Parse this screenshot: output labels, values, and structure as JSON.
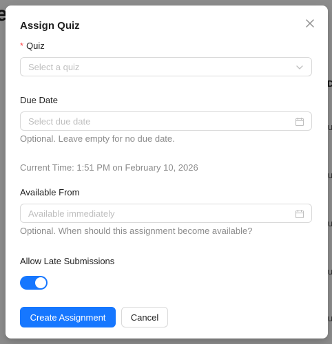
{
  "background": {
    "title_fragment": "e",
    "column_header_fragment": "D",
    "cell_fragment": "lu"
  },
  "modal": {
    "title": "Assign Quiz",
    "close_icon": "close-icon",
    "quiz": {
      "required_mark": "*",
      "label": "Quiz",
      "placeholder": "Select a quiz",
      "icon": "chevron-down-icon"
    },
    "due_date": {
      "label": "Due Date",
      "placeholder": "Select due date",
      "icon": "calendar-icon",
      "help": "Optional. Leave empty for no due date."
    },
    "current_time": "Current Time: 1:51 PM on February 10, 2026",
    "available_from": {
      "label": "Available From",
      "placeholder": "Available immediately",
      "icon": "calendar-icon",
      "help": "Optional. When should this assignment become available?"
    },
    "late_submissions": {
      "label": "Allow Late Submissions",
      "enabled": true
    },
    "buttons": {
      "create": "Create Assignment",
      "cancel": "Cancel"
    }
  },
  "colors": {
    "primary": "#1677ff",
    "required": "#ff4d4f",
    "help_text": "#8c8c8c",
    "border": "#d9d9d9",
    "placeholder": "#bfbfbf"
  }
}
